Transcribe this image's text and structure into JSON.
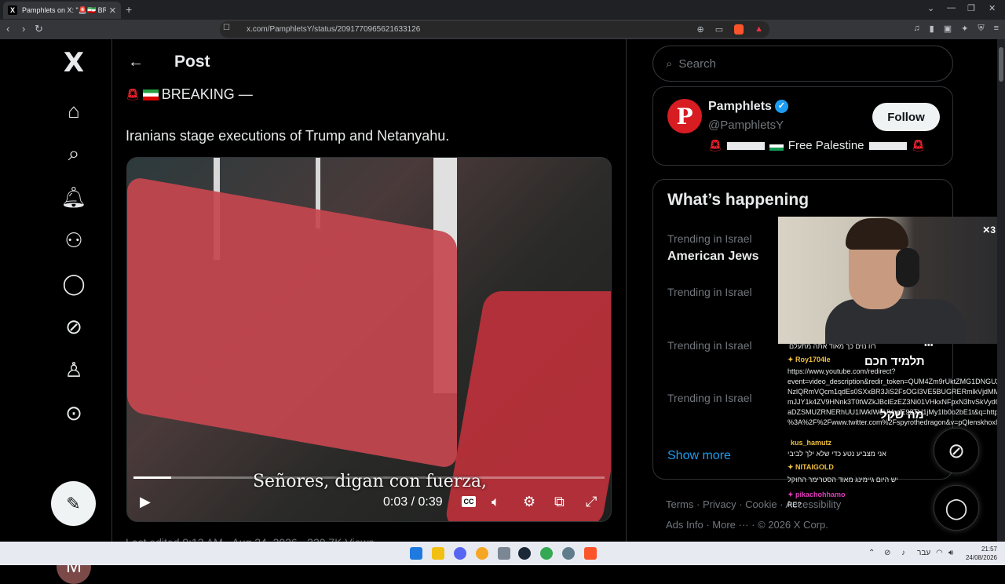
{
  "browser": {
    "tab_title": "Pamphlets on X: \"🚨🇮🇷 BREAKING",
    "favicon": "X",
    "url": "x.com/PamphletsY/status/2091770965621633126"
  },
  "nav": {
    "logo": "X",
    "avatar_letter": "M"
  },
  "post": {
    "header": "Post",
    "breaking_text": "BREAKING —",
    "text": "Iranians stage executions of Trump and Netanyahu.",
    "video": {
      "subtitle": "Señores, digan con fuerza,",
      "time": "0:03 / 0:39",
      "progress": 0.08,
      "cc_label": "CC"
    },
    "below_text": "Last edited 9:13 AM · Aug 24, 2026 · 220.7K Views"
  },
  "search": {
    "placeholder": "Search"
  },
  "profile": {
    "name": "Pamphlets",
    "handle": "@PamphletsY",
    "bio_text": "Free Palestine",
    "follow_label": "Follow",
    "logo_letter": "P"
  },
  "happening": {
    "title": "What’s happening",
    "trends": [
      {
        "category": "Trending in Israel",
        "title": "American Jews"
      },
      {
        "category": "Trending in Israel",
        "title": ""
      },
      {
        "category": "Trending in Israel",
        "title": ""
      },
      {
        "category": "Trending in Israel",
        "title": ""
      }
    ],
    "show_more": "Show more"
  },
  "footer": {
    "line1": [
      "Terms",
      "Privacy",
      "Cookie",
      "Accessibility"
    ],
    "line2": [
      "Ads Info",
      "More ···",
      "© 2026 X Corp."
    ]
  },
  "chat": {
    "first_line": "רוו נוים כך מאוד אתה מתעלם",
    "messages": [
      {
        "user": "Roy1704le",
        "lines": [
          "https://www.youtube.com/redirect?",
          "event=video_description&redir_token=QUM4Zm9rUktZMG1DNGU2",
          "NzlQRmVQcm1qdEs0SXxBR3JiS2FsOGI3VE5BUGRERmlkVjdMMVVCV",
          "mJJY1k4ZV9HNnk3T0tWZkJBclEzEZ3Ni01VHkxNFpxN3hvSkVydGhN",
          "aDZSMUZRNERhUU1IWklWeUVpdE92TU1jMy1Ib0o2bE1t&q=https",
          "%3A%2F%2Fwww.twitter.com%2Fspyrothedragon&v=pQlenskhoxI"
        ]
      },
      {
        "user": "kus_hamutz",
        "lines": [
          "אני מצביע נטע כדי שלא ילך לביבי"
        ]
      },
      {
        "user": "NITAIGOLD",
        "lines": [
          "יש היום גיימינג מאוד הסטרימר החוקל"
        ]
      },
      {
        "user": "pikachohhamo",
        "lines": [
          "RE?"
        ]
      }
    ],
    "overlay_1": "תלמיד חכם",
    "overlay_2": "מה שקל"
  },
  "taskbar": {
    "lang": "עבר",
    "time": "21:57",
    "date": "24/08/2026"
  },
  "colors": {
    "accent": "#1d9bf0",
    "siren": "#f4212e",
    "border": "#2f3336"
  }
}
